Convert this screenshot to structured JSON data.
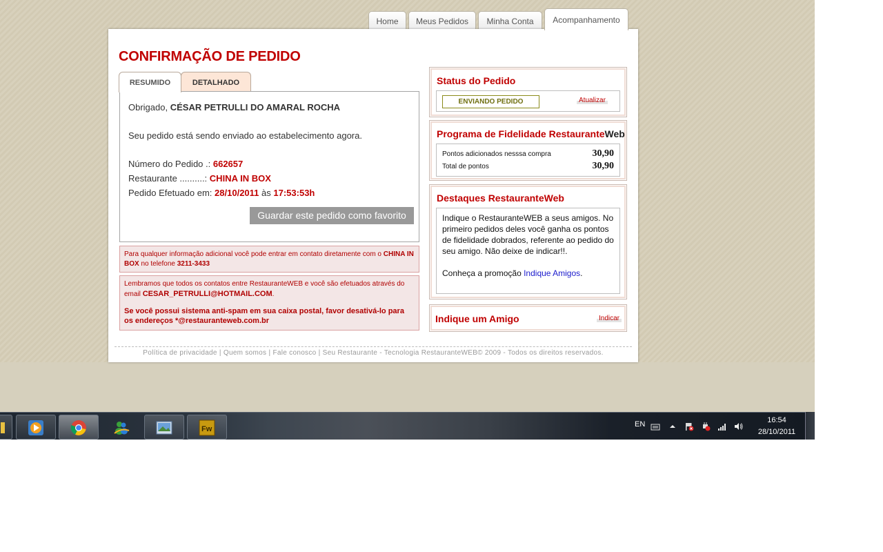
{
  "nav": {
    "tabs": [
      "Home",
      "Meus Pedidos",
      "Minha Conta",
      "Acompanhamento"
    ],
    "active": "Acompanhamento"
  },
  "page_title": "CONFIRMAÇÃO DE PEDIDO",
  "inner_tabs": {
    "resumido": "RESUMIDO",
    "detalhado": "DETALHADO"
  },
  "summary": {
    "thanks_prefix": "Obrigado,",
    "customer_name": "CÉSAR PETRULLI DO AMARAL ROCHA",
    "sending_message": "Seu pedido está sendo enviado ao estabelecimento agora.",
    "order_number_label": "Número do Pedido .:",
    "order_number": "662657",
    "restaurant_label": "Restaurante ..........:",
    "restaurant": "CHINA IN BOX",
    "placed_label": "Pedido Efetuado em:",
    "placed_date": "28/10/2011",
    "placed_at": "às",
    "placed_time": "17:53:53h",
    "favorite_button": "Guardar este pedido como favorito"
  },
  "contact_info": {
    "text_1": "Para qualquer informação adicional você pode entrar em contato diretamente com o",
    "restaurant": "CHINA IN BOX",
    "text_2": "no telefone",
    "phone": "3211-3433"
  },
  "email_info": {
    "text_1": "Lembramos que todos os contatos entre RestauranteWEB e você são efetuados através do email",
    "email": "CESAR_PETRULLI@HOTMAIL.COM",
    "period": ".",
    "antispam": "Se você possui sistema anti-spam em sua caixa postal, favor desativá-lo para os endereços *@restauranteweb.com.br"
  },
  "status": {
    "title": "Status do Pedido",
    "badge": "ENVIANDO PEDIDO",
    "refresh": "Atualizar"
  },
  "loyalty": {
    "title_main": "Programa de Fidelidade Restaurante",
    "title_suffix": "Web",
    "rows": [
      {
        "label": "Pontos adicionados nesssa compra",
        "value": "30,90"
      },
      {
        "label": "Total de pontos",
        "value": "30,90"
      }
    ]
  },
  "highlights": {
    "title": "Destaques RestauranteWeb",
    "text": "Indique o RestauranteWEB a seus amigos. No primeiro pedidos deles você ganha os pontos de fidelidade dobrados, referente ao pedido do seu amigo. Não deixe de indicar!!.",
    "promo_prefix": "Conheça a promoção",
    "promo_link": "Indique Amigos",
    "promo_suffix": "."
  },
  "refer": {
    "title": "Indique um Amigo",
    "link": "Indicar"
  },
  "footer": {
    "privacy": "Política de privacidade",
    "about": "Quem somos",
    "contact": "Fale conosco",
    "restaurant": "Seu Restaurante",
    "copyright": "Tecnologia RestauranteWEB© 2009 - Todos os direitos reservados.",
    "sep": "|",
    "dash": "-"
  },
  "taskbar": {
    "language": "EN",
    "time": "16:54",
    "date": "28/10/2011"
  },
  "colors": {
    "brand_red": "#c00000",
    "status_olive": "#6f6f10",
    "link_blue": "#1a1acc"
  }
}
